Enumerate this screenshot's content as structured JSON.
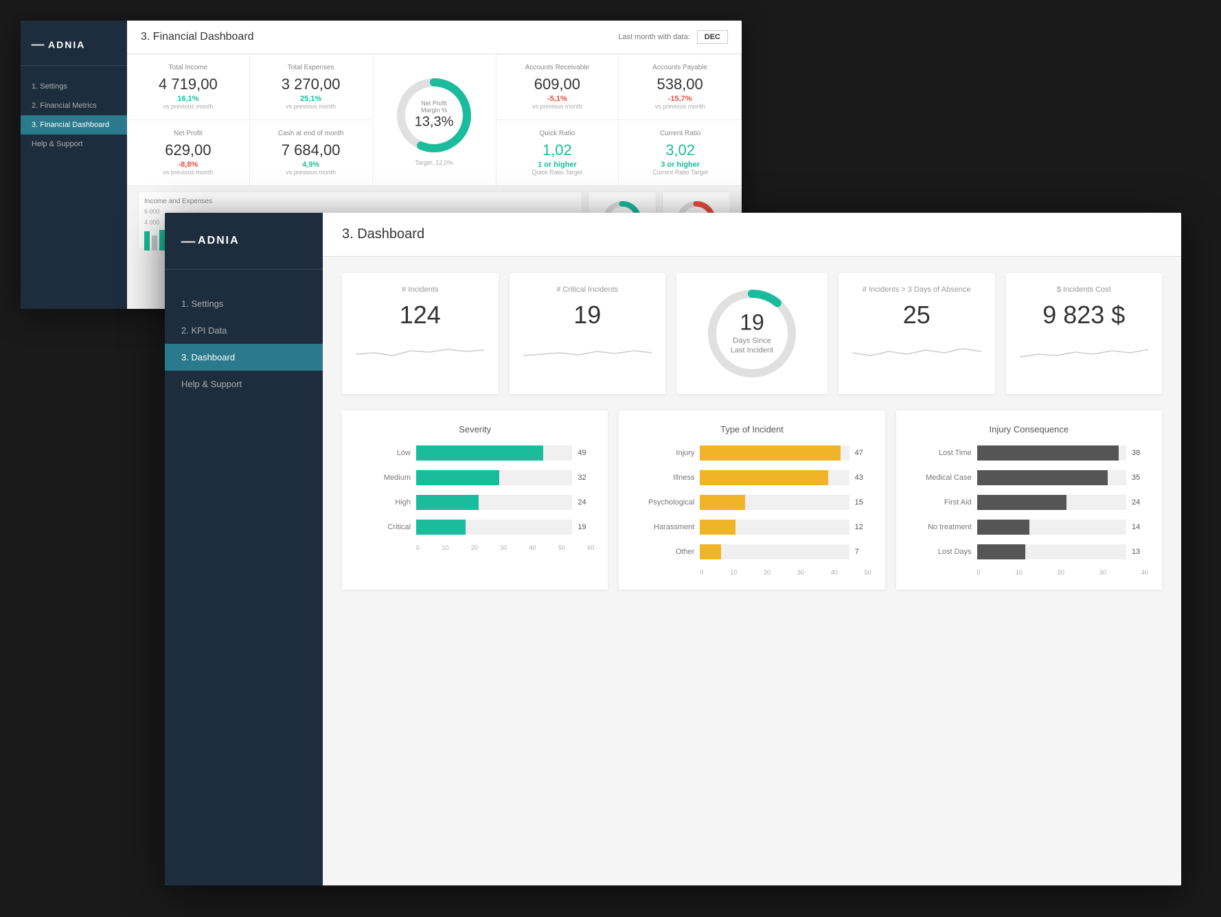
{
  "financial": {
    "title": "3. Financial Dashboard",
    "last_month_label": "Last month with data:",
    "last_month_value": "DEC",
    "sidebar": {
      "logo": "ADNIA",
      "nav": [
        {
          "label": "1. Settings",
          "active": false
        },
        {
          "label": "2. Financial Metrics",
          "active": false
        },
        {
          "label": "3. Financial Dashboard",
          "active": true
        },
        {
          "label": "Help & Support",
          "active": false
        }
      ]
    },
    "metrics_row1": [
      {
        "label": "Total Income",
        "value": "4 719,00",
        "change": "16,1%",
        "pos": true,
        "prev": "vs previous month"
      },
      {
        "label": "Total Expenses",
        "value": "3 270,00",
        "change": "25,1%",
        "pos": true,
        "prev": "vs previous month"
      }
    ],
    "donut": {
      "label": "Net Profit Margin %",
      "value": "13,3%",
      "target": "Target: 12,0%",
      "filled_pct": 55
    },
    "metrics_row1_right": [
      {
        "label": "Accounts Receivable",
        "value": "609,00",
        "change": "-5,1%",
        "pos": false,
        "prev": "vs previous month"
      },
      {
        "label": "Accounts Payable",
        "value": "538,00",
        "change": "-15,7%",
        "pos": false,
        "prev": "vs previous month"
      }
    ],
    "metrics_row2": [
      {
        "label": "Net Profit",
        "value": "629,00",
        "change": "-8,8%",
        "pos": false,
        "prev": "vs previous month"
      },
      {
        "label": "Cash at end of month",
        "value": "7 684,00",
        "change": "4,9%",
        "pos": true,
        "prev": "vs previous month"
      }
    ],
    "metrics_row2_right": [
      {
        "label": "Quick Ratio",
        "value": "1,02",
        "change": "1 or higher",
        "pos": true,
        "sub": "Quick Ratio Target"
      },
      {
        "label": "Current Ratio",
        "value": "3,02",
        "change": "3 or higher",
        "pos": true,
        "sub": "Current Ratio Target"
      }
    ],
    "bottom_chart_label": "Income and Expenses",
    "bottom_axis": [
      "6 000",
      "4 000"
    ]
  },
  "safety": {
    "title": "3. Dashboard",
    "sidebar": {
      "logo": "ADNIA",
      "nav": [
        {
          "label": "1. Settings",
          "active": false
        },
        {
          "label": "2. KPI Data",
          "active": false
        },
        {
          "label": "3. Dashboard",
          "active": true
        },
        {
          "label": "Help & Support",
          "active": false
        }
      ]
    },
    "kpis": [
      {
        "label": "# Incidents",
        "value": "124"
      },
      {
        "label": "# Critical Incidents",
        "value": "19"
      },
      {
        "label": "days_since",
        "value": "19",
        "sub": "Days Since\nLast Incident"
      },
      {
        "label": "# Incidents > 3 Days of Absence",
        "value": "25"
      },
      {
        "label": "$ Incidents Cost",
        "value": "9 823 $"
      }
    ],
    "severity": {
      "title": "Severity",
      "bars": [
        {
          "label": "Low",
          "value": 49,
          "max": 60
        },
        {
          "label": "Medium",
          "value": 32,
          "max": 60
        },
        {
          "label": "High",
          "value": 24,
          "max": 60
        },
        {
          "label": "Critical",
          "value": 19,
          "max": 60
        }
      ],
      "axis": [
        "0",
        "10",
        "20",
        "30",
        "40",
        "50",
        "60"
      ]
    },
    "type_of_incident": {
      "title": "Type of Incident",
      "bars": [
        {
          "label": "Injury",
          "value": 47,
          "max": 50
        },
        {
          "label": "Illness",
          "value": 43,
          "max": 50
        },
        {
          "label": "Psychological",
          "value": 15,
          "max": 50
        },
        {
          "label": "Harassment",
          "value": 12,
          "max": 50
        },
        {
          "label": "Other",
          "value": 7,
          "max": 50
        }
      ],
      "axis": [
        "0",
        "10",
        "20",
        "30",
        "40",
        "50"
      ]
    },
    "injury_consequence": {
      "title": "Injury Consequence",
      "bars": [
        {
          "label": "Lost Time",
          "value": 38,
          "max": 40
        },
        {
          "label": "Medical Case",
          "value": 35,
          "max": 40
        },
        {
          "label": "First Aid",
          "value": 24,
          "max": 40
        },
        {
          "label": "No treatment",
          "value": 14,
          "max": 40
        },
        {
          "label": "Lost Days",
          "value": 13,
          "max": 40
        }
      ],
      "axis": [
        "0",
        "10",
        "20",
        "30",
        "40"
      ]
    }
  }
}
